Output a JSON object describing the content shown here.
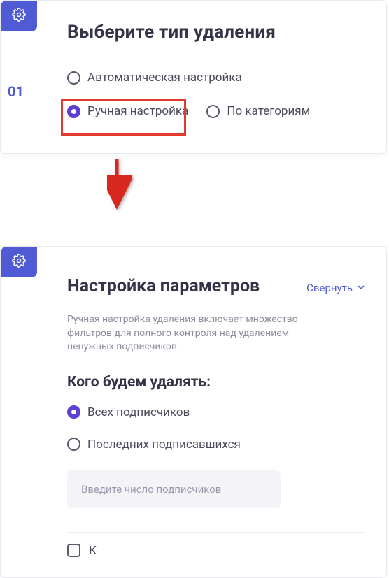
{
  "step": "01",
  "card1": {
    "title": "Выберите тип удаления",
    "options": [
      {
        "label": "Автоматическая настройка",
        "selected": false
      },
      {
        "label": "Ручная настройка",
        "selected": true
      },
      {
        "label": "По категориям",
        "selected": false
      }
    ]
  },
  "card2": {
    "title": "Настройка параметров",
    "collapse_label": "Свернуть",
    "description": "Ручная настройка удаления включает множество фильтров для полного контроля над удалением ненужных подписчиков.",
    "sub_title": "Кого будем удалять:",
    "who_options": [
      {
        "label": "Всех подписчиков",
        "selected": true
      },
      {
        "label": "Последних подписавшихся",
        "selected": false
      }
    ],
    "input_placeholder": "Введите число подписчиков",
    "checkbox_label_partial": "К"
  }
}
